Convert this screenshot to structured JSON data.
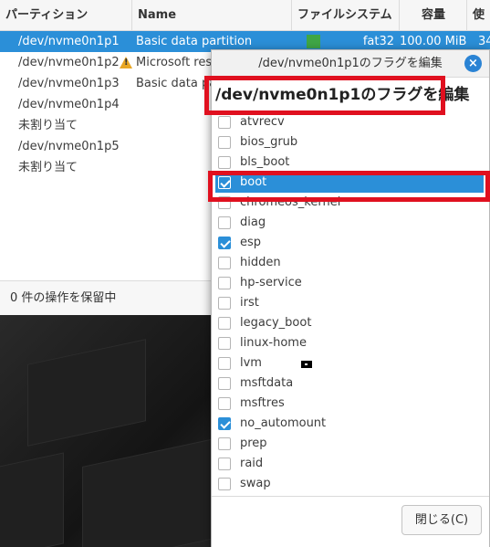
{
  "table": {
    "headers": [
      "パーティション",
      "Name",
      "ファイルシステム",
      "容量",
      "使"
    ],
    "rows": [
      {
        "partition": "/dev/nvme0n1p1",
        "name": "Basic data partition",
        "fs": "fat32",
        "size": "100.00 MiB",
        "used": "34",
        "selected": true,
        "warning": false
      },
      {
        "partition": "/dev/nvme0n1p2",
        "name": "Microsoft rese",
        "fs": "",
        "size": "",
        "used": "",
        "selected": false,
        "warning": true
      },
      {
        "partition": "/dev/nvme0n1p3",
        "name": "Basic data pa",
        "fs": "",
        "size": "",
        "used": "",
        "selected": false,
        "warning": false
      },
      {
        "partition": "/dev/nvme0n1p4",
        "name": "",
        "fs": "",
        "size": "",
        "used": "",
        "selected": false,
        "warning": false
      },
      {
        "partition": "未割り当て",
        "name": "",
        "fs": "",
        "size": "",
        "used": "",
        "selected": false,
        "warning": false
      },
      {
        "partition": "/dev/nvme0n1p5",
        "name": "",
        "fs": "",
        "size": "",
        "used": "",
        "selected": false,
        "warning": false
      },
      {
        "partition": "未割り当て",
        "name": "",
        "fs": "",
        "size": "",
        "used": "",
        "selected": false,
        "warning": false
      }
    ]
  },
  "status": {
    "pending": "0 件の操作を保留中"
  },
  "dialog": {
    "title": "/dev/nvme0n1p1のフラグを編集",
    "heading": "/dev/nvme0n1p1のフラグを編集",
    "close_icon": "×",
    "close_button": "閉じる(C)",
    "flags": [
      {
        "label": "atvrecv",
        "checked": false,
        "highlighted": false
      },
      {
        "label": "bios_grub",
        "checked": false,
        "highlighted": false
      },
      {
        "label": "bls_boot",
        "checked": false,
        "highlighted": false
      },
      {
        "label": "boot",
        "checked": true,
        "highlighted": true
      },
      {
        "label": "chromeos_kernel",
        "checked": false,
        "highlighted": false
      },
      {
        "label": "diag",
        "checked": false,
        "highlighted": false
      },
      {
        "label": "esp",
        "checked": true,
        "highlighted": false
      },
      {
        "label": "hidden",
        "checked": false,
        "highlighted": false
      },
      {
        "label": "hp-service",
        "checked": false,
        "highlighted": false
      },
      {
        "label": "irst",
        "checked": false,
        "highlighted": false
      },
      {
        "label": "legacy_boot",
        "checked": false,
        "highlighted": false
      },
      {
        "label": "linux-home",
        "checked": false,
        "highlighted": false
      },
      {
        "label": "lvm",
        "checked": false,
        "highlighted": false
      },
      {
        "label": "msftdata",
        "checked": false,
        "highlighted": false
      },
      {
        "label": "msftres",
        "checked": false,
        "highlighted": false
      },
      {
        "label": "no_automount",
        "checked": true,
        "highlighted": false
      },
      {
        "label": "prep",
        "checked": false,
        "highlighted": false
      },
      {
        "label": "raid",
        "checked": false,
        "highlighted": false
      },
      {
        "label": "swap",
        "checked": false,
        "highlighted": false
      }
    ]
  },
  "colors": {
    "accent": "#2b8fd8",
    "annotation": "#e0101f",
    "fs_fat32": "#3fa646"
  }
}
